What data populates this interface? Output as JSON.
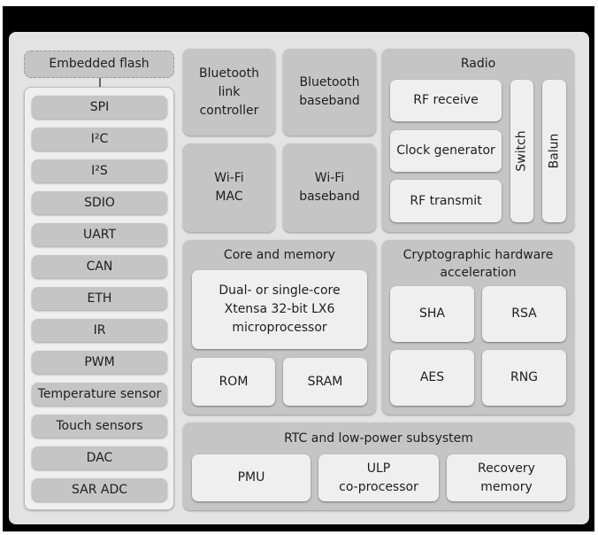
{
  "embedded_flash": "Embedded flash",
  "peripherals": [
    "SPI",
    "I²C",
    "I²S",
    "SDIO",
    "UART",
    "CAN",
    "ETH",
    "IR",
    "PWM",
    "Temperature sensor",
    "Touch sensors",
    "DAC",
    "SAR ADC"
  ],
  "bluetooth": {
    "link_controller": "Bluetooth\nlink\ncontroller",
    "baseband": "Bluetooth\nbaseband"
  },
  "wifi": {
    "mac": "Wi-Fi\nMAC",
    "baseband": "Wi-Fi\nbaseband"
  },
  "radio": {
    "title": "Radio",
    "rf_receive": "RF receive",
    "clock_generator": "Clock generator",
    "rf_transmit": "RF transmit",
    "switch": "Switch",
    "balun": "Balun"
  },
  "core": {
    "title": "Core and memory",
    "processor": "Dual- or single-core\nXtensa 32-bit LX6\nmicroprocessor",
    "rom": "ROM",
    "sram": "SRAM"
  },
  "crypto": {
    "title": "Cryptographic hardware\nacceleration",
    "sha": "SHA",
    "rsa": "RSA",
    "aes": "AES",
    "rng": "RNG"
  },
  "rtc": {
    "title": "RTC and low-power subsystem",
    "pmu": "PMU",
    "ulp": "ULP\nco-processor",
    "recovery": "Recovery\nmemory"
  }
}
